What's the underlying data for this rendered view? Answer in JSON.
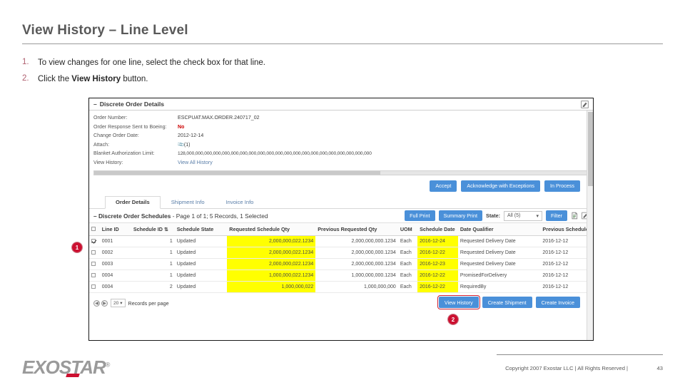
{
  "slide": {
    "title": "View History – Line Level",
    "steps": [
      {
        "num": "1.",
        "text_before": "To view changes for one line, select the check box for that line.",
        "bold": "",
        "text_after": ""
      },
      {
        "num": "2.",
        "text_before": "Click the ",
        "bold": "View History",
        "text_after": " button."
      }
    ]
  },
  "markers": {
    "one": "1",
    "two": "2"
  },
  "app": {
    "order_details": {
      "panel_title": "Discrete Order Details",
      "collapse_glyph": "–",
      "edit_icon": "edit-icon",
      "rows": [
        {
          "label": "Order Number:",
          "value": "ESCPUAT.MAX.ORDER.240717_02"
        },
        {
          "label": "Order Response Sent to Boeing:",
          "value": "No"
        },
        {
          "label": "Change Order Date:",
          "value": "2012-12-14"
        },
        {
          "label": "Attach:",
          "value": "(1)"
        },
        {
          "label": "Blanket Authorization Limit:",
          "value": "128,000,000,000,000,000,000,000,000,000,000,000,000,000,000,000,000,000,000,000,000,000"
        },
        {
          "label": "View History:",
          "value": "View All History"
        }
      ]
    },
    "action_buttons": [
      "Accept",
      "Acknowledge with Exceptions",
      "In Process"
    ],
    "tabs": [
      {
        "label": "Order Details",
        "active": true
      },
      {
        "label": "Shipment Info",
        "active": false
      },
      {
        "label": "Invoice Info",
        "active": false
      }
    ],
    "schedules": {
      "title": "Discrete Order Schedules",
      "collapse_glyph": "–",
      "subtitle": "- Page 1 of 1; 5 Records, 1 Selected",
      "tools": {
        "full_print": "Full Print",
        "summary_print": "Summary Print",
        "state_label": "State:",
        "state_value": "All (5)",
        "filter": "Filter",
        "export_icon": "document-export-icon",
        "edit_icon": "edit-icon"
      },
      "columns": [
        "Line ID",
        "Schedule ID",
        "Schedule State",
        "Requested Schedule Qty",
        "Previous Requested Qty",
        "UOM",
        "Schedule Date",
        "Date Qualifier",
        "Previous Schedule Date"
      ],
      "rows": [
        {
          "selected": true,
          "line_id": "0001",
          "schedule_id": "1",
          "state": "Updated",
          "req_qty": "2,000,000,022.1234",
          "prev_qty": "2,000,000,000.1234",
          "uom": "Each",
          "sched_date": "2016-12-24",
          "qualifier": "Requested Delivery Date",
          "prev_sched_date": "2016-12-12"
        },
        {
          "selected": false,
          "line_id": "0002",
          "schedule_id": "1",
          "state": "Updated",
          "req_qty": "2,000,000,022.1234",
          "prev_qty": "2,000,000,000.1234",
          "uom": "Each",
          "sched_date": "2016-12-22",
          "qualifier": "Requested Delivery Date",
          "prev_sched_date": "2016-12-12"
        },
        {
          "selected": false,
          "line_id": "0003",
          "schedule_id": "1",
          "state": "Updated",
          "req_qty": "2,000,000,022.1234",
          "prev_qty": "2,000,000,000.1234",
          "uom": "Each",
          "sched_date": "2016-12-23",
          "qualifier": "Requested Delivery Date",
          "prev_sched_date": "2016-12-12"
        },
        {
          "selected": false,
          "line_id": "0004",
          "schedule_id": "1",
          "state": "Updated",
          "req_qty": "1,000,000,022.1234",
          "prev_qty": "1,000,000,000.1234",
          "uom": "Each",
          "sched_date": "2016-12-22",
          "qualifier": "PromisedForDelivery",
          "prev_sched_date": "2016-12-12"
        },
        {
          "selected": false,
          "line_id": "0004",
          "schedule_id": "2",
          "state": "Updated",
          "req_qty": "1,000,000,022",
          "prev_qty": "1,000,000,000",
          "uom": "Each",
          "sched_date": "2016-12-22",
          "qualifier": "RequiredBy",
          "prev_sched_date": "2016-12-12"
        }
      ],
      "paging": {
        "prev_icon": "prev-page-icon",
        "next_icon": "next-page-icon",
        "records_per_page_value": "20",
        "records_per_page_label": "Records per page"
      },
      "bottom_buttons": [
        "View History",
        "Create Shipment",
        "Create Invoice"
      ]
    }
  },
  "footer": {
    "logo_text": "EXOSTAR",
    "logo_mark": "®",
    "copyright": "Copyright 2007 Exostar LLC | All Rights Reserved |",
    "page_number": "43"
  },
  "colors": {
    "accent_blue": "#4a90d9",
    "highlight": "#ffff00",
    "marker_red": "#cc1030",
    "link": "#5a7ea8",
    "alert_red": "#cc0000"
  }
}
